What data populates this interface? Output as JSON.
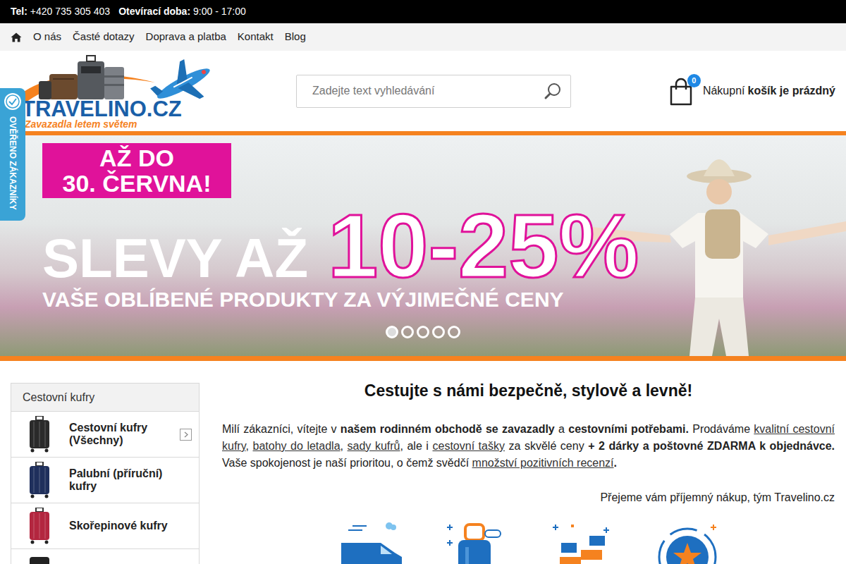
{
  "topbar": {
    "phone_label": "Tel:",
    "phone": "+420 735 305 403",
    "hours_label": "Otevírací doba:",
    "hours": "9:00 - 17:00"
  },
  "nav": [
    {
      "label": "O nás"
    },
    {
      "label": "Časté dotazy"
    },
    {
      "label": "Doprava a platba"
    },
    {
      "label": "Kontakt"
    },
    {
      "label": "Blog"
    }
  ],
  "logo": {
    "title": "TRAVELINO.CZ",
    "tagline": "Zavazadla letem světem"
  },
  "search": {
    "placeholder": "Zadejte text vyhledávání"
  },
  "cart": {
    "count": "0",
    "label": "Nákupní",
    "status": "košík je prázdný"
  },
  "verified_badge": {
    "label": "OVĚŘENO ZÁKAZNÍKY"
  },
  "banner": {
    "tag": "AŽ DO",
    "date": "30. ČERVNA!",
    "headline": "SLEVY AŽ",
    "discount": "10-25%",
    "subtitle": "VAŠE OBLÍBENÉ PRODUKTY ZA VÝJIMEČNÉ CENY",
    "dots": [
      {
        "selected": true
      },
      {
        "selected": false
      },
      {
        "selected": false
      },
      {
        "selected": false
      },
      {
        "selected": false
      }
    ]
  },
  "sidebar": {
    "title": "Cestovní kufry",
    "items": [
      {
        "label": "Cestovní kufry (Všechny)",
        "expandable": true,
        "color": "#2a2a2a"
      },
      {
        "label": "Palubní (příruční) kufry",
        "expandable": false,
        "color": "#1f2f5c"
      },
      {
        "label": "Skořepinové kufry",
        "expandable": false,
        "color": "#b3263f"
      }
    ]
  },
  "intro": {
    "heading": "Cestujte s námi bezpečně, stylově a levně!",
    "paragraph": [
      {
        "kind": "text",
        "text": "Milí zákazníci, vítejte v "
      },
      {
        "kind": "bold",
        "text": "našem rodinném obchodě se zavazadly"
      },
      {
        "kind": "text",
        "text": " a "
      },
      {
        "kind": "bold",
        "text": "cestovními potřebami."
      },
      {
        "kind": "text",
        "text": " Prodáváme "
      },
      {
        "kind": "link",
        "text": "kvalitní cestovní kufry"
      },
      {
        "kind": "text",
        "text": ", "
      },
      {
        "kind": "link",
        "text": "batohy do letadla"
      },
      {
        "kind": "text",
        "text": ", "
      },
      {
        "kind": "link",
        "text": "sady kufrů"
      },
      {
        "kind": "text",
        "text": ", ale i "
      },
      {
        "kind": "link",
        "text": "cestovní tašky"
      },
      {
        "kind": "text",
        "text": " za skvělé ceny "
      },
      {
        "kind": "bold",
        "text": "+ 2 dárky a poštovné ZDARMA k objednávce."
      },
      {
        "kind": "text",
        "text": " Vaše spokojenost je naší prioritou, o čemž svědčí "
      },
      {
        "kind": "link",
        "text": "množství pozitivních recenzí"
      },
      {
        "kind": "bold",
        "text": "."
      }
    ],
    "signature": "Přejeme vám příjemný nákup, tým Travelino.cz"
  },
  "features": [
    {
      "kind": "delivery"
    },
    {
      "kind": "suitcase"
    },
    {
      "kind": "gifts"
    },
    {
      "kind": "star"
    }
  ]
}
